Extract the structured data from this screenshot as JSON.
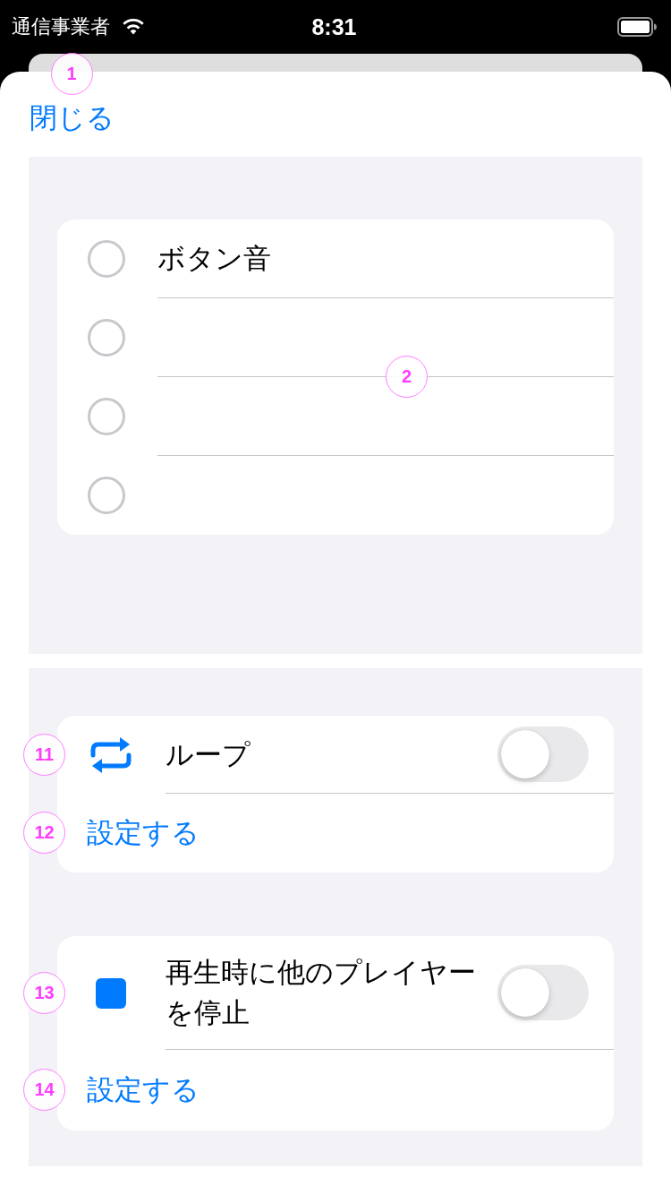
{
  "status_bar": {
    "carrier": "通信事業者",
    "time": "8:31"
  },
  "close_button": {
    "label": "閉じる",
    "marker": "1"
  },
  "radio_list": {
    "marker": "2",
    "items": [
      {
        "label": "ボタン音",
        "selected": false
      },
      {
        "selected": false
      },
      {
        "selected": false
      },
      {
        "selected": false
      }
    ]
  },
  "settings_sections": [
    {
      "rows": [
        {
          "kind": "toggle",
          "label": "ループ",
          "on": false,
          "marker": "11"
        },
        {
          "kind": "link",
          "label": "設定する",
          "marker": "12"
        }
      ]
    },
    {
      "rows": [
        {
          "kind": "toggle",
          "label": "再生時に他のプレイヤーを停止",
          "on": false,
          "marker": "13"
        },
        {
          "kind": "link",
          "label": "設定する",
          "marker": "14"
        }
      ]
    }
  ]
}
